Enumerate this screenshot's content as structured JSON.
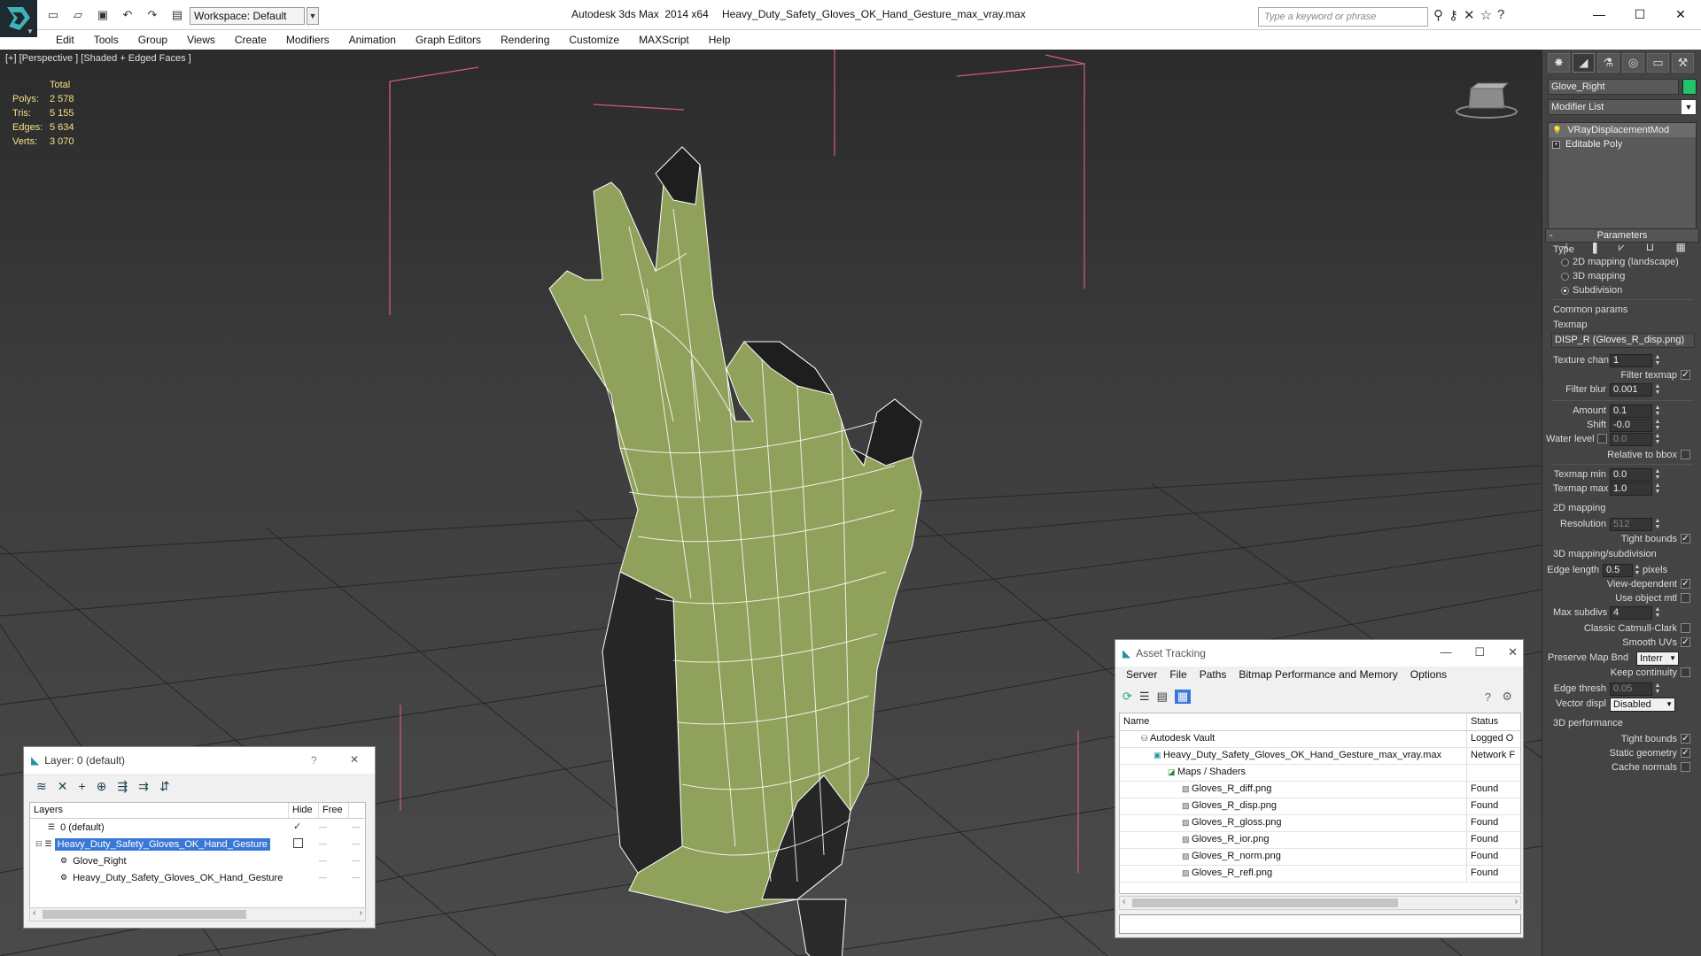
{
  "title_bar": {
    "app_title": "Autodesk 3ds Max  2014 x64",
    "file_name": "Heavy_Duty_Safety_Gloves_OK_Hand_Gesture_max_vray.max",
    "workspace": "Workspace: Default",
    "search_placeholder": "Type a keyword or phrase"
  },
  "menu": [
    "Edit",
    "Tools",
    "Group",
    "Views",
    "Create",
    "Modifiers",
    "Animation",
    "Graph Editors",
    "Rendering",
    "Customize",
    "MAXScript",
    "Help"
  ],
  "viewport": {
    "label": "[+] [Perspective ] [Shaded + Edged Faces ]",
    "stats_header": "Total",
    "stats": [
      {
        "k": "Polys:",
        "v": "2 578"
      },
      {
        "k": "Tris:",
        "v": "5 155"
      },
      {
        "k": "Edges:",
        "v": "5 634"
      },
      {
        "k": "Verts:",
        "v": "3 070"
      }
    ]
  },
  "command_panel": {
    "object_name": "Glove_Right",
    "object_color": "#23c46a",
    "modifier_list": "Modifier List",
    "stack": [
      "VRayDisplacementMod",
      "Editable Poly"
    ],
    "rollout_title": "Parameters",
    "type_label": "Type",
    "type_options": [
      "2D mapping (landscape)",
      "3D mapping",
      "Subdivision"
    ],
    "common_params": "Common params",
    "texmap_label": "Texmap",
    "texmap_value": "DISP_R (Gloves_R_disp.png)",
    "texture_chan_label": "Texture chan",
    "texture_chan": "1",
    "filter_texmap": "Filter texmap",
    "filter_blur_label": "Filter blur",
    "filter_blur": "0.001",
    "amount_label": "Amount",
    "amount": "0.1",
    "shift_label": "Shift",
    "shift": "-0.0",
    "water_level_label": "Water level",
    "water_level": "0.0",
    "relative_bbox": "Relative to bbox",
    "texmap_min_label": "Texmap min",
    "texmap_min": "0.0",
    "texmap_max_label": "Texmap max",
    "texmap_max": "1.0",
    "group_2d": "2D mapping",
    "resolution_label": "Resolution",
    "resolution": "512",
    "tight_bounds": "Tight bounds",
    "group_3d": "3D mapping/subdivision",
    "edge_length_label": "Edge length",
    "edge_length": "0.5",
    "pixels": "pixels",
    "view_dependent": "View-dependent",
    "use_object_mtl": "Use object mtl",
    "max_subdivs_label": "Max subdivs",
    "max_subdivs": "4",
    "classic_catmull": "Classic Catmull-Clark",
    "smooth_uvs": "Smooth UVs",
    "preserve_map_bnd": "Preserve Map Bnd",
    "preserve_map_value": "Interr",
    "keep_continuity": "Keep continuity",
    "edge_thresh_label": "Edge thresh",
    "edge_thresh": "0.05",
    "vector_displ_label": "Vector displ",
    "vector_displ_value": "Disabled",
    "group_perf": "3D performance",
    "tight_bounds2": "Tight bounds",
    "static_geometry": "Static geometry",
    "cache_normals": "Cache normals"
  },
  "layers": {
    "title": "Layer: 0 (default)",
    "columns": [
      "Layers",
      "Hide",
      "Free"
    ],
    "rows": [
      {
        "name": "0 (default)",
        "indent": 1,
        "selected": false
      },
      {
        "name": "Heavy_Duty_Safety_Gloves_OK_Hand_Gesture",
        "indent": 1,
        "selected": true
      },
      {
        "name": "Glove_Right",
        "indent": 2,
        "selected": false
      },
      {
        "name": "Heavy_Duty_Safety_Gloves_OK_Hand_Gesture",
        "indent": 2,
        "selected": false
      }
    ]
  },
  "assets": {
    "title": "Asset Tracking",
    "menus": [
      "Server",
      "File",
      "Paths",
      "Bitmap Performance and Memory",
      "Options"
    ],
    "columns": [
      "Name",
      "Status"
    ],
    "rows": [
      {
        "name": "Autodesk Vault",
        "status": "Logged O",
        "indent": 1
      },
      {
        "name": "Heavy_Duty_Safety_Gloves_OK_Hand_Gesture_max_vray.max",
        "status": "Network F",
        "indent": 2
      },
      {
        "name": "Maps / Shaders",
        "status": "",
        "indent": 3
      },
      {
        "name": "Gloves_R_diff.png",
        "status": "Found",
        "indent": 4
      },
      {
        "name": "Gloves_R_disp.png",
        "status": "Found",
        "indent": 4
      },
      {
        "name": "Gloves_R_gloss.png",
        "status": "Found",
        "indent": 4
      },
      {
        "name": "Gloves_R_ior.png",
        "status": "Found",
        "indent": 4
      },
      {
        "name": "Gloves_R_norm.png",
        "status": "Found",
        "indent": 4
      },
      {
        "name": "Gloves_R_refl.png",
        "status": "Found",
        "indent": 4
      }
    ]
  }
}
